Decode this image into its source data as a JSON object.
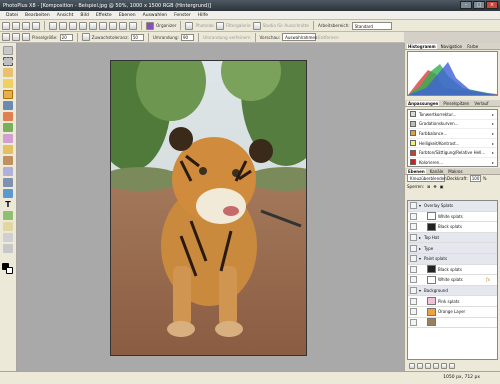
{
  "window": {
    "title": "PhotoPlus X8 - [Komposition - Beispiel.jpg @ 50%, 1000 x 1500 RGB (Hintergrund)]"
  },
  "menu": [
    "Datei",
    "Bearbeiten",
    "Ansicht",
    "Bild",
    "Effekte",
    "Ebenen",
    "Auswahlen",
    "Fenster",
    "Hilfe"
  ],
  "toolbar": {
    "photolab": "Photolab",
    "filtergalerie": "Filtergalerie",
    "studio": "Studio für Ausschnitte",
    "arbeitsbereich": "Arbeitsbereich:",
    "arbeitsbereich_value": "Standard",
    "organizer": "Organizer"
  },
  "context_toolbar": {
    "pinselgroesse_label": "Pinselgröße:",
    "pinselgroesse_value": "20",
    "zuwachs_label": "Zuwachstoleranz:",
    "zuwachs_value": "50",
    "umrandung_label": "Umrandung:",
    "umrandung_value": "90",
    "verfeinern": "Umrandung verfeinern",
    "vorschau_label": "Vorschau:",
    "vorschau_value": "Auswahlrahmen",
    "entfernen": "Entfernen"
  },
  "panels": {
    "histogram_tabs": [
      "Histogramm",
      "Navigation",
      "Farbe"
    ],
    "adjust_tabs": [
      "Anpassungen",
      "Pinselspitzen",
      "Verlauf"
    ],
    "adjustments": [
      {
        "label": "Tonwertkorrektur...",
        "color": "#d8d8d8"
      },
      {
        "label": "Gradationskurven...",
        "color": "#bcbcbc"
      },
      {
        "label": "Farbbalance...",
        "color": "#e0a040"
      },
      {
        "label": "Helligkeit/Kontrast...",
        "color": "#f0f080"
      },
      {
        "label": "Farbton/Sättigung/Relative Hell...",
        "color": "#c04040"
      },
      {
        "label": "Kolorieren...",
        "color": "#d02020"
      }
    ],
    "layer_tabs": [
      "Ebenen",
      "Kanäle",
      "Makros"
    ],
    "blend_mode": "Kreuzüberblenden",
    "opacity_label": "Deckkraft:",
    "opacity_value": "100",
    "sperren_label": "Sperren:",
    "layers": [
      {
        "name": "Overlay Splats",
        "type": "group"
      },
      {
        "name": "White splats",
        "type": "sub"
      },
      {
        "name": "Black splats",
        "type": "sub"
      },
      {
        "name": "Top Hat",
        "type": "group"
      },
      {
        "name": "Type",
        "type": "group"
      },
      {
        "name": "Paint splats",
        "type": "group"
      },
      {
        "name": "Black splats",
        "type": "sub"
      },
      {
        "name": "White splats",
        "type": "sub"
      },
      {
        "name": "Background",
        "type": "group"
      },
      {
        "name": "Pink splats",
        "type": "sub"
      },
      {
        "name": "Orange Layer",
        "type": "sub"
      },
      {
        "name": "",
        "type": "sub"
      }
    ]
  },
  "status": {
    "coords": "1050 px, 712 px"
  },
  "colors": {
    "titlebar": "#3a434b",
    "workspace": "#a9a9a9",
    "panel": "#ece9d8"
  }
}
